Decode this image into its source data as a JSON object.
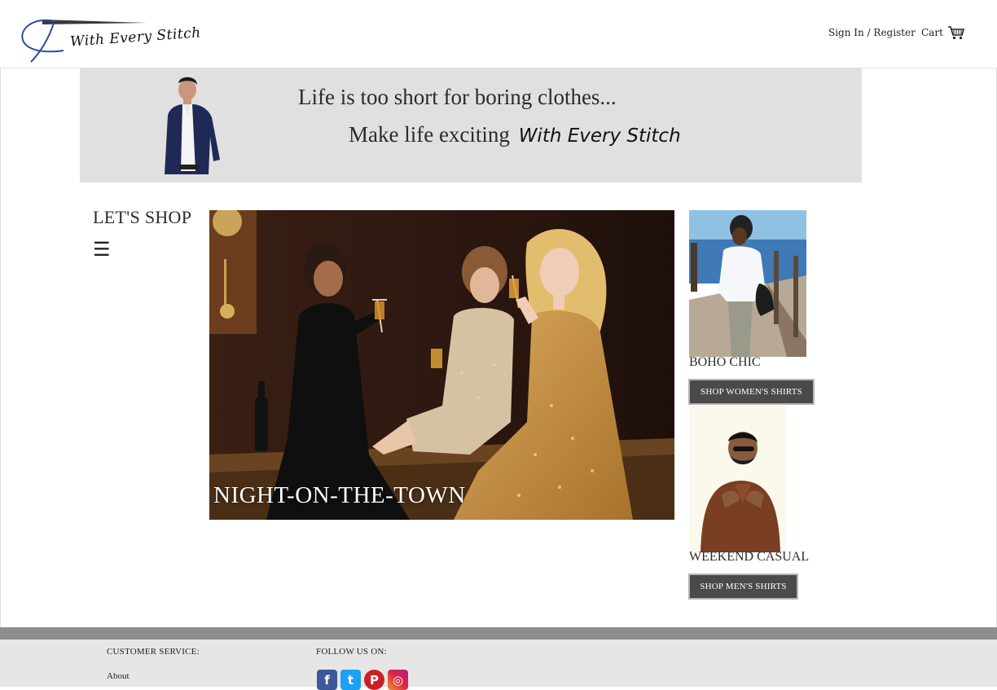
{
  "header": {
    "logo_text": "With Every Stitch",
    "signin_label": "Sign In / Register",
    "cart_label": "Cart"
  },
  "banner": {
    "line1": "Life is too short for boring clothes...",
    "line2": "Make life exciting",
    "brand": "With Every Stitch"
  },
  "sidebar": {
    "title": "LET'S SHOP",
    "menu_glyph": "☰"
  },
  "hero": {
    "caption": "NIGHT-ON-THE-TOWN"
  },
  "promos": [
    {
      "label": "BOHO CHIC",
      "button": "SHOP WOMEN'S SHIRTS"
    },
    {
      "label": "WEEKEND CASUAL",
      "button": "SHOP MEN'S SHIRTS"
    }
  ],
  "footer": {
    "customer_service_heading": "CUSTOMER SERVICE:",
    "follow_heading": "FOLLOW US ON:",
    "about_link": "About",
    "social": [
      {
        "name": "facebook-icon",
        "glyph": "f"
      },
      {
        "name": "twitter-icon",
        "glyph": "t"
      },
      {
        "name": "pinterest-icon",
        "glyph": "P"
      },
      {
        "name": "instagram-icon",
        "glyph": "◎"
      }
    ]
  },
  "colors": {
    "banner_bg": "#e0e0e0",
    "button_bg": "#4a4a4a",
    "footer_bar": "#8e8e8e",
    "footer_bg": "#e6e6e6",
    "logo_blue": "#2a4a9c"
  }
}
